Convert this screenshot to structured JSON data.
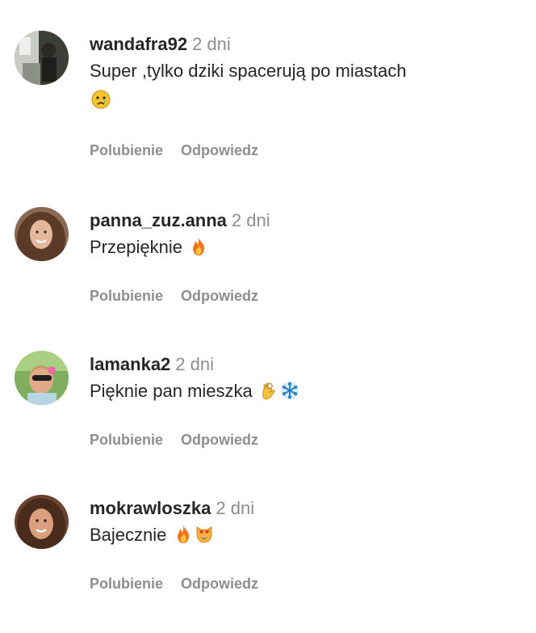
{
  "comments": [
    {
      "username": "wandafra92",
      "time": "2 dni",
      "text": "Super ,tylko dziki spacerują po miastach",
      "emojis": [
        "crying-face-emoji"
      ],
      "like_label": "Polubienie",
      "reply_label": "Odpowiedz"
    },
    {
      "username": "panna_zuz.anna",
      "time": "2 dni",
      "text": "Przepięknie",
      "emojis": [
        "fire-emoji"
      ],
      "like_label": "Polubienie",
      "reply_label": "Odpowiedz"
    },
    {
      "username": "lamanka2",
      "time": "2 dni",
      "text": "Pięknie pan mieszka",
      "emojis": [
        "ok-hand-emoji",
        "snowflake-emoji"
      ],
      "like_label": "Polubienie",
      "reply_label": "Odpowiedz"
    },
    {
      "username": "mokrawloszka",
      "time": "2 dni",
      "text": "Bajecznie",
      "emojis": [
        "fire-emoji",
        "heart-eyes-cat-emoji"
      ],
      "like_label": "Polubienie",
      "reply_label": "Odpowiedz"
    }
  ],
  "colors": {
    "text": "#262626",
    "muted": "#8e8e8e",
    "background": "#ffffff"
  }
}
